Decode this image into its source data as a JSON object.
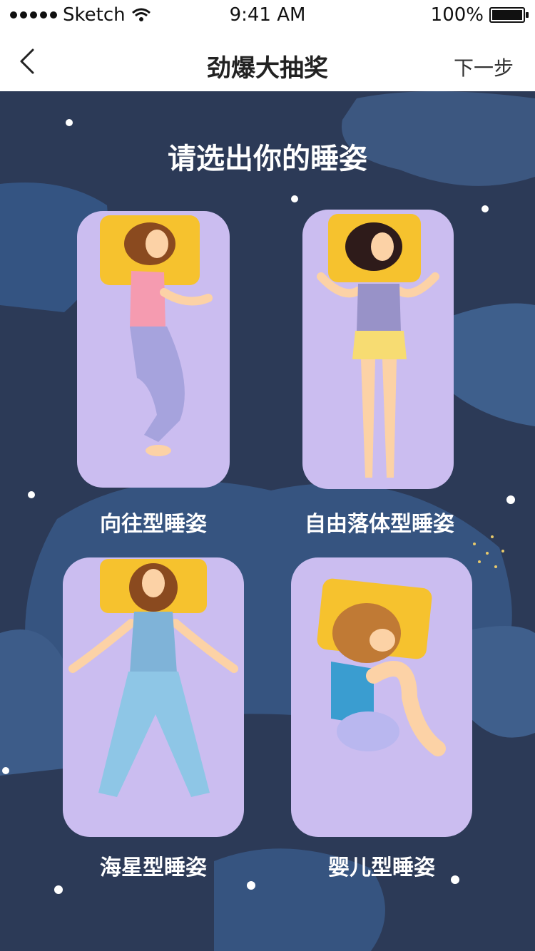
{
  "status_bar": {
    "carrier": "Sketch",
    "time": "9:41 AM",
    "battery": "100%"
  },
  "nav": {
    "title": "劲爆大抽奖",
    "next_label": "下一步"
  },
  "main": {
    "heading": "请选出你的睡姿",
    "options": [
      {
        "label": "向往型睡姿"
      },
      {
        "label": "自由落体型睡姿"
      },
      {
        "label": "海星型睡姿"
      },
      {
        "label": "婴儿型睡姿"
      }
    ]
  },
  "colors": {
    "background": "#2c3a57",
    "mattress": "#cbbdf0",
    "pillow": "#f6c22e",
    "text": "#ffffff"
  }
}
